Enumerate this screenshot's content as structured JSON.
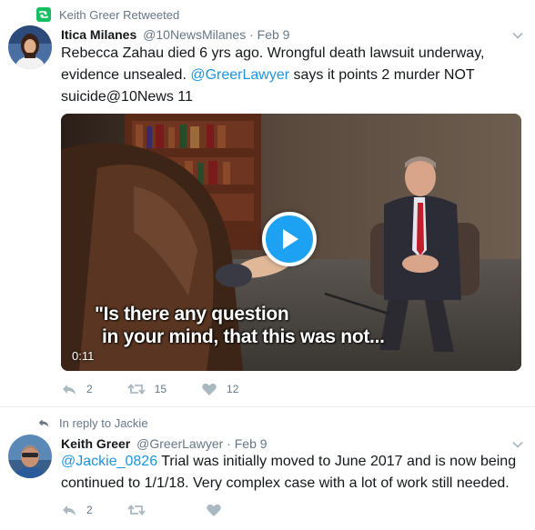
{
  "tweet1": {
    "context_label": "Keith Greer Retweeted",
    "author_name": "Itica Milanes",
    "author_handle": "@10NewsMilanes",
    "separator": "·",
    "date": "Feb 9",
    "text_part1": "Rebecca Zahau died 6 yrs ago. Wrongful death lawsuit underway, evidence unsealed. ",
    "mention": "@GreerLawyer",
    "text_part2": " says it points 2 murder NOT suicide@10News 11",
    "video": {
      "caption_line1": "\"Is there any question",
      "caption_line2": "in your mind, that this was not...",
      "duration": "0:11"
    },
    "actions": {
      "replies": "2",
      "retweets": "15",
      "likes": "12"
    }
  },
  "tweet2": {
    "context_label": "In reply to Jackie",
    "author_name": "Keith Greer",
    "author_handle": "@GreerLawyer",
    "separator": "·",
    "date": "Feb 9",
    "mention": "@Jackie_0826",
    "text_rest": " Trial was initially moved to June 2017 and is now being continued to 1/1/18. Very complex case with a lot of work still needed.",
    "actions": {
      "replies": "2",
      "retweets": "",
      "likes": ""
    }
  },
  "colors": {
    "retweet_green": "#17bf63",
    "link_blue": "#1b95e0",
    "muted_gray": "#657786",
    "play_blue": "#1da1f2"
  },
  "icons": [
    "retweet-icon",
    "reply-icon",
    "heart-icon",
    "chevron-down-icon",
    "play-icon"
  ]
}
